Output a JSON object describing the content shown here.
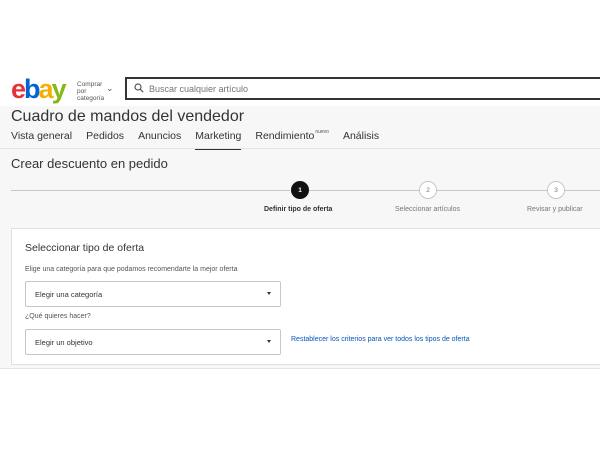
{
  "header": {
    "logo": {
      "e": "e",
      "b": "b",
      "a": "a",
      "y": "y"
    },
    "shop_by_label": "Comprar por categoría",
    "search": {
      "placeholder": "Buscar cualquier artículo",
      "icon": "search-icon"
    }
  },
  "dashboard": {
    "title": "Cuadro de mandos del vendedor",
    "tabs": [
      {
        "label": "Vista general"
      },
      {
        "label": "Pedidos"
      },
      {
        "label": "Anuncios"
      },
      {
        "label": "Marketing",
        "active": true
      },
      {
        "label": "Rendimiento",
        "badge": "nuevo"
      },
      {
        "label": "Análisis"
      }
    ]
  },
  "page": {
    "title": "Crear descuento en pedido",
    "steps": [
      {
        "number": "1",
        "label": "Definir tipo de oferta",
        "active": true
      },
      {
        "number": "2",
        "label": "Seleccionar artículos",
        "active": false
      },
      {
        "number": "3",
        "label": "Revisar y publicar",
        "active": false
      }
    ]
  },
  "offer_card": {
    "title": "Seleccionar tipo de oferta",
    "category_hint": "Elige una categoría para que podamos recomendarte la mejor oferta",
    "category_select": "Elegir una categoría",
    "goal_question": "¿Qué quieres hacer?",
    "goal_select": "Elegir un objetivo",
    "reset_link": "Restablecer los criterios para ver todos los tipos de oferta"
  },
  "colors": {
    "logo_red": "#e53238",
    "logo_blue": "#0064d2",
    "logo_yellow": "#f5af02",
    "logo_green": "#86b817",
    "link": "#0654ba"
  }
}
